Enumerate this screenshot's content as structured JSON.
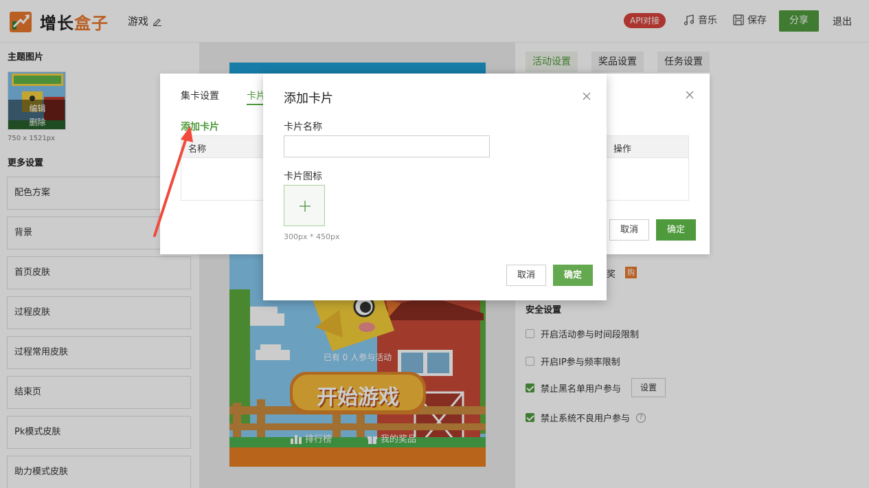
{
  "header": {
    "logo_part1": "增长",
    "logo_part2": "盒子",
    "game_name": "游戏",
    "api_badge": "API对接",
    "music_label": "音乐",
    "save_label": "保存",
    "share_label": "分享",
    "logout_label": "退出",
    "colors": {
      "brand_green": "#4f9a3c",
      "brand_orange": "#e8772e",
      "api_red": "#d9433b"
    }
  },
  "sidebar": {
    "theme_title": "主题图片",
    "thumb_edit": "编辑",
    "thumb_delete": "删除",
    "thumb_size": "750 x 1521px",
    "more_title": "更多设置",
    "items": [
      "配色方案",
      "背景",
      "首页皮肤",
      "过程皮肤",
      "过程常用皮肤",
      "结束页",
      "Pk模式皮肤",
      "助力模式皮肤"
    ]
  },
  "preview": {
    "participants_text": "已有 0 人参与活动",
    "start_button": "开始游戏",
    "rank_label": "排行榜",
    "prize_label": "我的奖品"
  },
  "right_panel": {
    "tabs": [
      "活动设置",
      "奖品设置",
      "任务设置"
    ],
    "partial_text": "奖",
    "buy_badge": "购",
    "security_title": "安全设置",
    "options": [
      {
        "label": "开启活动参与时间段限制",
        "checked": false
      },
      {
        "label": "开启IP参与频率限制",
        "checked": false
      },
      {
        "label": "禁止黑名单用户参与",
        "checked": true
      },
      {
        "label": "禁止系统不良用户参与",
        "checked": true
      }
    ],
    "set_button": "设置",
    "help_icon": "?"
  },
  "back_dialog": {
    "tabs": [
      "集卡设置",
      "卡片"
    ],
    "add_card_link": "添加卡片",
    "col_name": "名称",
    "col_action": "操作",
    "cancel_label": "取消",
    "ok_label": "确定"
  },
  "modal": {
    "title": "添加卡片",
    "name_label": "卡片名称",
    "name_value": "",
    "icon_label": "卡片图标",
    "size_hint": "300px * 450px",
    "cancel_label": "取消",
    "ok_label": "确定"
  }
}
